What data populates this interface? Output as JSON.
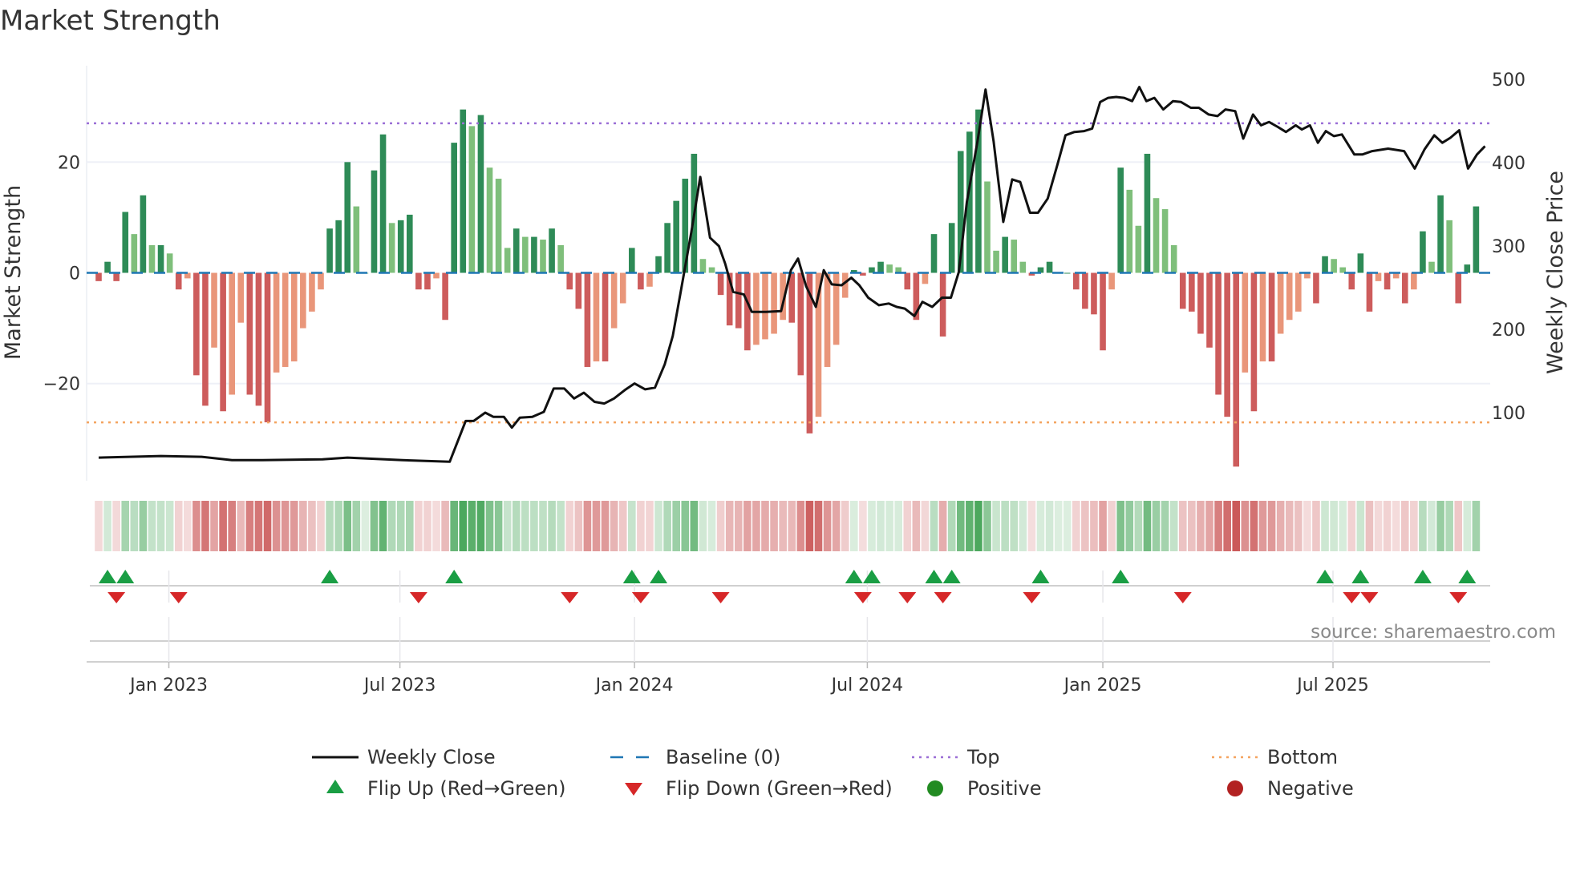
{
  "title": "Market Strength",
  "source": "source: sharemaestro.com",
  "colors": {
    "pos_rising": "#2e8b57",
    "pos_falling": "#7fbf7b",
    "neg_falling": "#cd5c5c",
    "neg_rising": "#e9967a",
    "price": "#111111",
    "baseline": "#1f77b4",
    "top": "#9b6fd6",
    "bottom": "#f4a460",
    "flip_up": "#1a9e44",
    "flip_down": "#d62728",
    "positive": "#228b22",
    "negative": "#b22222"
  },
  "chart_data": {
    "type": "bar",
    "title": "Market Strength",
    "xlabel": "",
    "ylabel": "Market Strength",
    "y2label": "Weekly Close Price",
    "ylim": [
      -37,
      37
    ],
    "y2lim": [
      20,
      520
    ],
    "yticks": [
      {
        "v": 20,
        "label": "20"
      },
      {
        "v": 0,
        "label": "0"
      },
      {
        "v": -20,
        "label": "−20"
      }
    ],
    "y2ticks": [
      {
        "v": 500,
        "label": "500"
      },
      {
        "v": 400,
        "label": "400"
      },
      {
        "v": 300,
        "label": "300"
      },
      {
        "v": 200,
        "label": "200"
      },
      {
        "v": 100,
        "label": "100"
      }
    ],
    "xticks": [
      {
        "week": 7.9,
        "label": "Jan 2023"
      },
      {
        "week": 33.9,
        "label": "Jul 2023"
      },
      {
        "week": 60.3,
        "label": "Jan 2024"
      },
      {
        "week": 86.5,
        "label": "Jul 2024"
      },
      {
        "week": 113.0,
        "label": "Jan 2025"
      },
      {
        "week": 138.9,
        "label": "Jul 2025"
      }
    ],
    "top_level": 27,
    "bottom_level": -27,
    "baseline": 0,
    "strength": [
      -1.5,
      2,
      -1.5,
      11,
      7,
      14,
      5,
      5,
      3.5,
      -3,
      -1,
      -18.5,
      -24,
      -13.5,
      -25,
      -22,
      -9,
      -22,
      -24,
      -27,
      -18,
      -17,
      -16,
      -10,
      -7,
      -3,
      8,
      9.5,
      20,
      12,
      0,
      18.5,
      25,
      9,
      9.5,
      10.5,
      -3,
      -3,
      -1,
      -8.5,
      23.5,
      29.5,
      26.5,
      28.5,
      19,
      17,
      4.5,
      8,
      6.5,
      6.5,
      6,
      8,
      5,
      -3,
      -6.5,
      -17,
      -16,
      -16,
      -10,
      -5.5,
      4.5,
      -3,
      -2.5,
      3,
      9,
      13,
      17,
      21.5,
      2.5,
      1,
      -4,
      -9.5,
      -10,
      -14,
      -13,
      -12,
      -11,
      -8.5,
      -9,
      -18.5,
      -29,
      -26,
      -17,
      -13,
      -4.5,
      0.5,
      -0.5,
      1,
      2,
      1.5,
      1,
      -3,
      -8.5,
      -2,
      7,
      -11.5,
      9,
      22,
      25.5,
      29.5,
      16.5,
      4,
      6.5,
      6,
      2,
      -0.5,
      1,
      2,
      0,
      0,
      -3,
      -6.5,
      -7.5,
      -14,
      -3,
      19,
      15,
      8.5,
      21.5,
      13.5,
      11.5,
      5,
      -6.5,
      -7,
      -11,
      -13.5,
      -22,
      -26,
      -35,
      -18,
      -25,
      -16,
      -16,
      -11,
      -8.5,
      -7,
      -1,
      -5.5,
      3,
      2.5,
      1,
      -3,
      3.5,
      -7,
      -1.5,
      -3,
      -1,
      -5.5,
      -3,
      7.5,
      2,
      14,
      9.5,
      -5.5,
      1.5,
      12
    ],
    "price_points": [
      [
        0,
        46
      ],
      [
        7,
        48
      ],
      [
        11.6,
        47
      ],
      [
        15,
        43
      ],
      [
        18.4,
        43
      ],
      [
        25.2,
        44
      ],
      [
        28,
        46
      ],
      [
        34.2,
        43
      ],
      [
        39.5,
        41
      ],
      [
        41.3,
        90
      ],
      [
        42.2,
        90
      ],
      [
        43.5,
        100
      ],
      [
        44.4,
        95
      ],
      [
        45.6,
        95
      ],
      [
        46.5,
        82
      ],
      [
        47.4,
        94
      ],
      [
        48.8,
        95
      ],
      [
        50.1,
        101
      ],
      [
        51.2,
        129
      ],
      [
        52.4,
        129
      ],
      [
        53.5,
        117
      ],
      [
        54.6,
        124
      ],
      [
        55.8,
        113
      ],
      [
        56.9,
        111
      ],
      [
        58,
        117
      ],
      [
        59.2,
        127
      ],
      [
        60.3,
        135
      ],
      [
        61.5,
        128
      ],
      [
        62.6,
        130
      ],
      [
        63.7,
        158
      ],
      [
        64.6,
        192
      ],
      [
        65.5,
        245
      ],
      [
        66.7,
        317
      ],
      [
        67.7,
        383
      ],
      [
        68.8,
        310
      ],
      [
        69.8,
        300
      ],
      [
        70.5,
        279
      ],
      [
        71.4,
        245
      ],
      [
        72.6,
        242
      ],
      [
        73.5,
        221
      ],
      [
        75.1,
        221
      ],
      [
        76.8,
        222
      ],
      [
        77.9,
        271
      ],
      [
        78.7,
        285
      ],
      [
        79.6,
        252
      ],
      [
        80.7,
        227
      ],
      [
        81.6,
        271
      ],
      [
        82.5,
        254
      ],
      [
        83.6,
        253
      ],
      [
        84.7,
        262
      ],
      [
        85.6,
        253
      ],
      [
        86.6,
        238
      ],
      [
        87.8,
        229
      ],
      [
        88.9,
        231
      ],
      [
        89.8,
        227
      ],
      [
        90.7,
        225
      ],
      [
        91.8,
        216
      ],
      [
        92.7,
        233
      ],
      [
        93.8,
        227
      ],
      [
        94.9,
        238
      ],
      [
        95.9,
        238
      ],
      [
        96.8,
        269
      ],
      [
        97.7,
        353
      ],
      [
        98.9,
        426
      ],
      [
        99.8,
        488
      ],
      [
        100.7,
        426
      ],
      [
        101.8,
        329
      ],
      [
        102.8,
        380
      ],
      [
        103.7,
        377
      ],
      [
        104.8,
        340
      ],
      [
        105.7,
        340
      ],
      [
        106.8,
        357
      ],
      [
        107.9,
        398
      ],
      [
        108.8,
        433
      ],
      [
        109.8,
        437
      ],
      [
        110.9,
        438
      ],
      [
        111.8,
        441
      ],
      [
        112.7,
        473
      ],
      [
        113.6,
        478
      ],
      [
        114.5,
        479
      ],
      [
        115.4,
        478
      ],
      [
        116.3,
        474
      ],
      [
        117.1,
        491
      ],
      [
        117.9,
        474
      ],
      [
        118.8,
        478
      ],
      [
        119.8,
        464
      ],
      [
        120.9,
        474
      ],
      [
        121.8,
        473
      ],
      [
        122.9,
        466
      ],
      [
        123.8,
        466
      ],
      [
        124.9,
        458
      ],
      [
        125.9,
        456
      ],
      [
        126.8,
        464
      ],
      [
        127.9,
        462
      ],
      [
        128.8,
        429
      ],
      [
        129.9,
        458
      ],
      [
        130.8,
        445
      ],
      [
        131.7,
        449
      ],
      [
        132.7,
        443
      ],
      [
        133.6,
        437
      ],
      [
        134.7,
        445
      ],
      [
        135.4,
        440
      ],
      [
        136.3,
        445
      ],
      [
        137.2,
        424
      ],
      [
        138.1,
        438
      ],
      [
        139,
        432
      ],
      [
        139.9,
        434
      ],
      [
        141.3,
        410
      ],
      [
        142.2,
        410
      ],
      [
        143.3,
        414
      ],
      [
        145.1,
        417
      ],
      [
        146.9,
        414
      ],
      [
        148.1,
        393
      ],
      [
        149.2,
        416
      ],
      [
        150.3,
        433
      ],
      [
        151.2,
        424
      ],
      [
        152.1,
        430
      ],
      [
        153.1,
        439
      ],
      [
        154.1,
        393
      ],
      [
        155.1,
        410
      ],
      [
        156,
        420
      ]
    ],
    "legend": {
      "placement": "bottom",
      "items": [
        {
          "label": "Weekly Close",
          "kind": "line"
        },
        {
          "label": "Baseline (0)",
          "kind": "dash"
        },
        {
          "label": "Top",
          "kind": "dot-top"
        },
        {
          "label": "Bottom",
          "kind": "dot-bottom"
        },
        {
          "label": "Flip Up (Red→Green)",
          "kind": "tri-up"
        },
        {
          "label": "Flip Down (Green→Red)",
          "kind": "tri-down"
        },
        {
          "label": "Positive",
          "kind": "dot-pos"
        },
        {
          "label": "Negative",
          "kind": "dot-neg"
        }
      ]
    }
  }
}
